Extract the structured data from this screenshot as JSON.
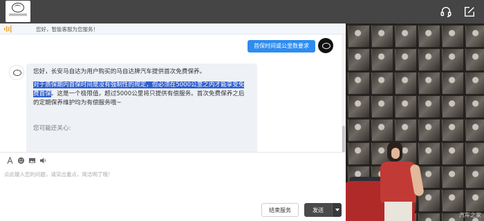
{
  "header": {
    "logo_name": "mazda-logo",
    "icons": [
      "headset-icon",
      "edit-icon"
    ]
  },
  "notice": {
    "text": "您好，智能客服为您服务！"
  },
  "conversation": {
    "user_message": "首保时间或公里数要求",
    "bot_message": {
      "intro": "您好，长安马自达为用户购买的马自达牌汽车提供首次免费保养。",
      "highlighted": "对于质保期内首保时间是没有强制性的规定，但必须在5000公里之内才能享受免费首保",
      "rest": "。这是一个极限值，超过5000公里将只提供有偿服务。首次免费保养之后的定期保养维护均为有偿服务哦~",
      "also_care": "您可能还关心:"
    }
  },
  "composer": {
    "placeholder": "点此输入您的问题，请突出重点，简洁明了哦！",
    "tools": [
      "font-icon",
      "emoji-icon",
      "image-icon",
      "voice-icon"
    ],
    "end_label": "结束服务",
    "send_label": "发送"
  },
  "ad": {
    "watermark": "汽车之家"
  },
  "colors": {
    "header_bg": "#454545",
    "user_bubble": "#2d8cf0",
    "bot_bubble": "#eef1f6",
    "highlight": "#2f5fd0"
  }
}
